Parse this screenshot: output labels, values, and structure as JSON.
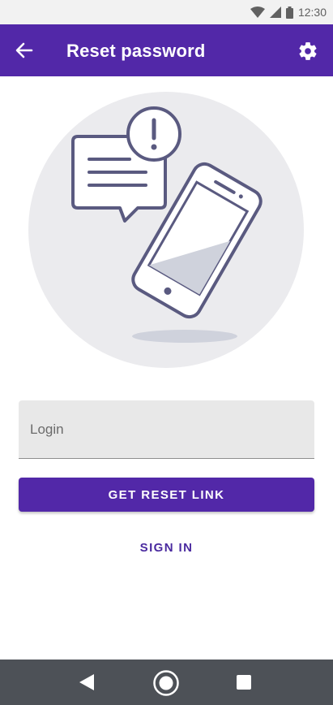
{
  "status_bar": {
    "time": "12:30",
    "icons": [
      "wifi-icon",
      "cell-signal-icon",
      "battery-icon"
    ]
  },
  "app_bar": {
    "title": "Reset password",
    "back_icon": "arrow-left-icon",
    "settings_icon": "gear-icon"
  },
  "illustration": {
    "subject": "phone-with-alert-message-icon"
  },
  "form": {
    "login_placeholder": "Login",
    "login_value": "",
    "submit_label": "GET RESET LINK",
    "sign_in_label": "SIGN IN"
  },
  "nav_bar": {
    "icons": [
      "nav-back-icon",
      "nav-home-icon",
      "nav-recents-icon"
    ]
  },
  "colors": {
    "primary": "#5228a8",
    "link": "#4a2a9f",
    "illustration_outline": "#5a5a80",
    "illustration_bg": "#ebebee",
    "nav_bar": "#4d5157"
  }
}
